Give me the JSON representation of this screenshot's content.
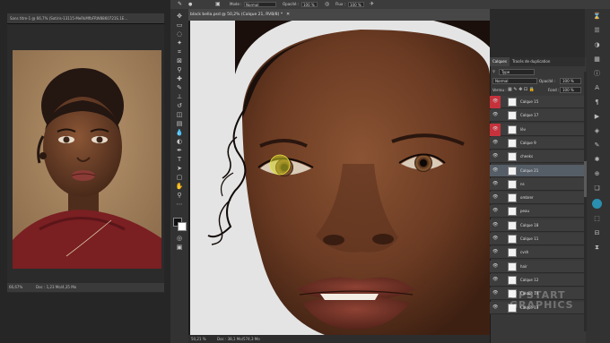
{
  "reference_window": {
    "title": "Sans titre-1 @ 66,7% (Sotiris-13115-MeRkMfbFRW8860721S.1E…",
    "zoom": "66,67%",
    "doc_info": "Doc : 1,23 Mo/4,35 Mo"
  },
  "options_bar": {
    "mode_label": "Mode :",
    "mode_value": "Normal",
    "opacity_label": "Opacité :",
    "opacity_value": "100 %",
    "flow_label": "Flux :",
    "flow_value": "100 %"
  },
  "document": {
    "tab_title": "black bella.psd @ 50,2% (Calque 21, RVB/8) *",
    "zoom": "50,21 %",
    "doc_info": "Doc : 38,1 Mo/574,3 Mo"
  },
  "layers_panel": {
    "tabs": [
      "Calques",
      "Tracés de duplication"
    ],
    "filter_value": "Type",
    "blend_mode": "Normal",
    "opacity_label": "Opacité :",
    "opacity_value": "100 %",
    "lock_label": "Verrou :",
    "fill_label": "Fond :",
    "fill_value": "100 %",
    "layers": [
      {
        "name": "Calque 15",
        "marked": true,
        "selected": false
      },
      {
        "name": "Calque 17",
        "marked": false,
        "selected": false
      },
      {
        "name": "lèv",
        "marked": true,
        "selected": false
      },
      {
        "name": "Calque 9",
        "marked": false,
        "selected": false
      },
      {
        "name": "cheeks",
        "marked": false,
        "selected": false
      },
      {
        "name": "Calque 21",
        "marked": false,
        "selected": true
      },
      {
        "name": "ns",
        "marked": false,
        "selected": false
      },
      {
        "name": "ombrer",
        "marked": false,
        "selected": false
      },
      {
        "name": "peau",
        "marked": false,
        "selected": false
      },
      {
        "name": "Calque 18",
        "marked": false,
        "selected": false
      },
      {
        "name": "Calque 11",
        "marked": false,
        "selected": false
      },
      {
        "name": "cvsh",
        "marked": false,
        "selected": false
      },
      {
        "name": "hair",
        "marked": false,
        "selected": false
      },
      {
        "name": "Calque 12",
        "marked": false,
        "selected": false
      },
      {
        "name": "Calque 14",
        "marked": false,
        "selected": false
      },
      {
        "name": "Calque 13",
        "marked": false,
        "selected": false
      }
    ]
  },
  "watermark": {
    "line1": "UPSTART",
    "line2": "GRAPHICS"
  },
  "colors": {
    "ui_dark": "#2a2a2a",
    "panel": "#383838",
    "selected_layer": "#555d66",
    "red_marker": "#c6323c",
    "canvas_bg": "#e4e4e4"
  }
}
